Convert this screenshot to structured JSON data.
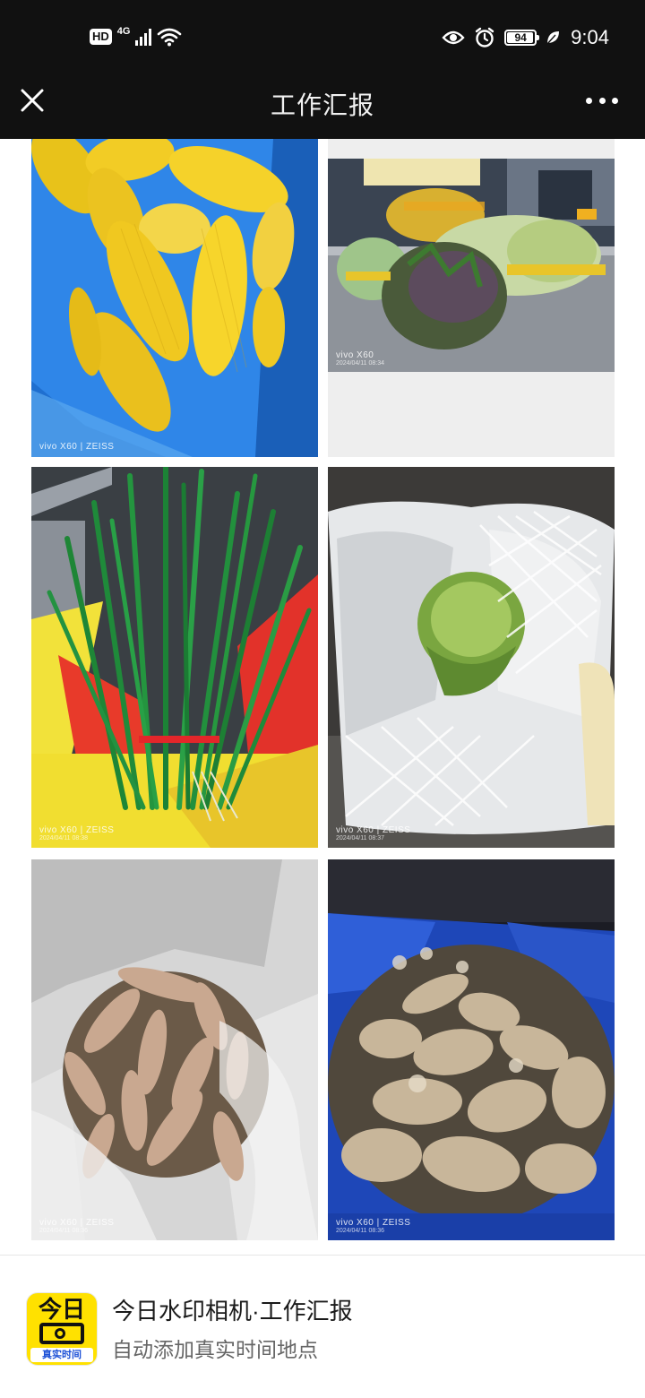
{
  "status_bar": {
    "hd_label": "HD",
    "network_label": "4G",
    "battery_level": "94",
    "time": "9:04",
    "icons": [
      "signal-icon",
      "wifi-icon",
      "eye-icon",
      "alarm-icon",
      "battery-icon",
      "leaf-icon"
    ]
  },
  "nav": {
    "title": "工作汇报",
    "close_icon": "close-icon",
    "more_icon": "more-icon"
  },
  "photos": [
    {
      "subject": "corn",
      "cam": "vivo X60 | ZEISS",
      "date": ""
    },
    {
      "subject": "bagged-vegetables",
      "cam": "vivo X60",
      "date": "2024/04/11 08:34"
    },
    {
      "subject": "chives",
      "cam": "vivo X60 | ZEISS",
      "date": "2024/04/11 08:38"
    },
    {
      "subject": "cabbage",
      "cam": "vivo X60 | ZEISS",
      "date": "2024/04/11 08:37"
    },
    {
      "subject": "sweet-potatoes",
      "cam": "vivo X60 | ZEISS",
      "date": "2024/04/11 08:36"
    },
    {
      "subject": "ginger",
      "cam": "vivo X60 | ZEISS",
      "date": "2024/04/11 08:36"
    }
  ],
  "banner": {
    "icon_top": "今日",
    "icon_bottom": "真实时间",
    "title": "今日水印相机·工作汇报",
    "subtitle": "自动添加真实时间地点"
  },
  "colors": {
    "bars": "#111111",
    "icon_yellow": "#ffe100",
    "icon_blue_text": "#1a4fd6"
  }
}
